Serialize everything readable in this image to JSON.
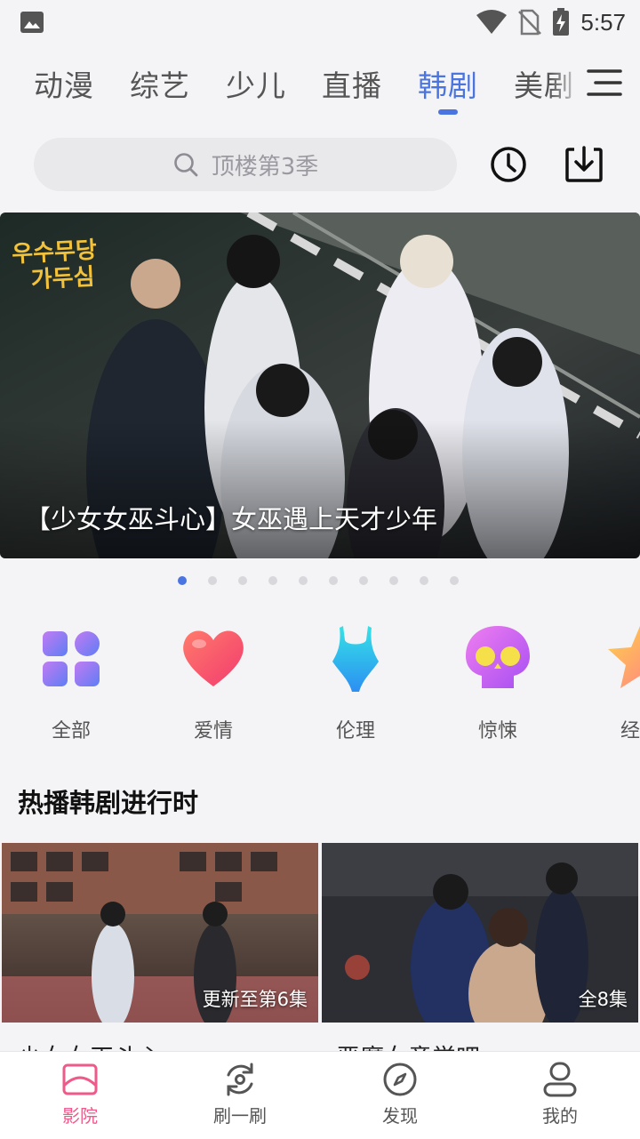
{
  "status_bar": {
    "time": "5:57"
  },
  "tabs": [
    {
      "label": "动漫"
    },
    {
      "label": "综艺"
    },
    {
      "label": "少儿"
    },
    {
      "label": "直播"
    },
    {
      "label": "韩剧"
    },
    {
      "label": "美剧"
    }
  ],
  "active_tab": "韩剧",
  "search": {
    "placeholder": "顶楼第3季"
  },
  "banner": {
    "logo_line1": "우수무당",
    "logo_line2": "가두심",
    "caption": "【少女女巫斗心】女巫遇上天才少年",
    "slide_count": 10,
    "active_slide": 1
  },
  "genres": [
    {
      "label": "全部",
      "icon": "grid-icon"
    },
    {
      "label": "爱情",
      "icon": "heart-icon"
    },
    {
      "label": "伦理",
      "icon": "swimsuit-icon"
    },
    {
      "label": "惊悚",
      "icon": "skull-icon"
    },
    {
      "label": "经",
      "icon": "star-icon"
    }
  ],
  "section": {
    "title": "热播韩剧进行时"
  },
  "cards": [
    {
      "badge": "更新至第6集",
      "title": "少女女巫斗心"
    },
    {
      "badge": "全8集",
      "title": "恶魔女童学吧"
    }
  ],
  "bottom_nav": [
    {
      "label": "影院",
      "icon": "cinema-icon"
    },
    {
      "label": "刷一刷",
      "icon": "refresh-icon"
    },
    {
      "label": "发现",
      "icon": "compass-icon"
    },
    {
      "label": "我的",
      "icon": "profile-icon"
    }
  ],
  "colors": {
    "accent": "#4a74e0",
    "nav_active": "#ef5a8a"
  }
}
